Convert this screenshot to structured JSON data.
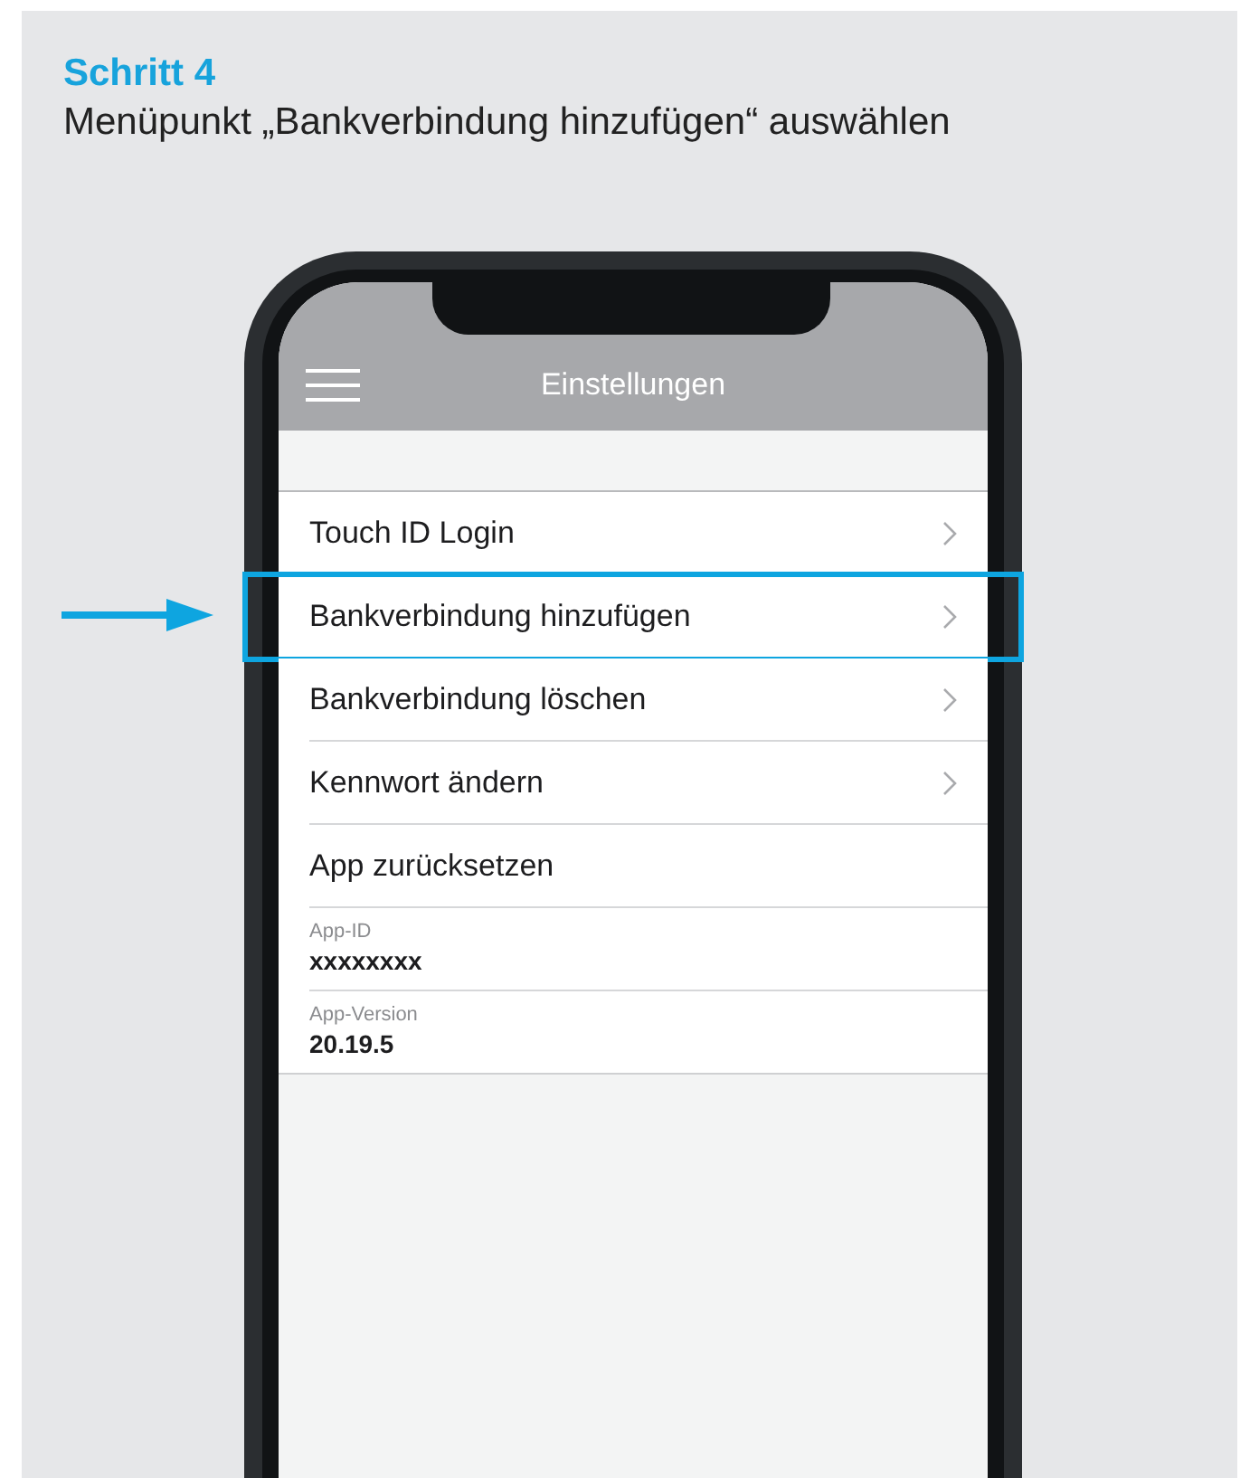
{
  "step": {
    "title": "Schritt 4",
    "instruction": "Menüpunkt „Bankverbindung hinzufügen“ auswählen"
  },
  "phone": {
    "header": {
      "title": "Einstellungen"
    },
    "rows": [
      {
        "kind": "nav",
        "label": "Touch ID Login",
        "highlighted": false
      },
      {
        "kind": "nav",
        "label": "Bankverbindung hinzufügen",
        "highlighted": true
      },
      {
        "kind": "nav",
        "label": "Bankverbindung löschen",
        "highlighted": false
      },
      {
        "kind": "nav",
        "label": "Kennwort ändern",
        "highlighted": false
      },
      {
        "kind": "action",
        "label": "App zurücksetzen",
        "highlighted": false
      },
      {
        "kind": "info",
        "label": "App-ID",
        "value": "xxxxxxxx",
        "highlighted": false
      },
      {
        "kind": "info",
        "label": "App-Version",
        "value": "20.19.5",
        "highlighted": false
      }
    ]
  }
}
